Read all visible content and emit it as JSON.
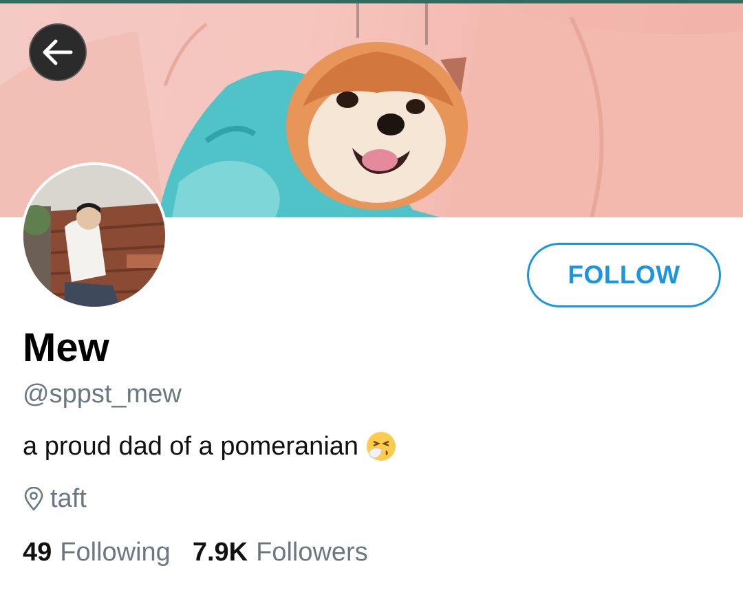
{
  "profile": {
    "name": "Mew",
    "handle": "@sppst_mew",
    "bio": "a proud dad of a pomeranian",
    "bio_emoji": "sneezing-face",
    "location": "taft"
  },
  "actions": {
    "follow_label": "FOLLOW",
    "back_icon": "arrow-left-icon"
  },
  "stats": {
    "following_count": "49",
    "following_label": "Following",
    "followers_count": "7.9K",
    "followers_label": "Followers"
  },
  "colors": {
    "accent": "#1b95e0",
    "secondary_text": "#697882",
    "banner_pink": "#f3c2ba"
  }
}
